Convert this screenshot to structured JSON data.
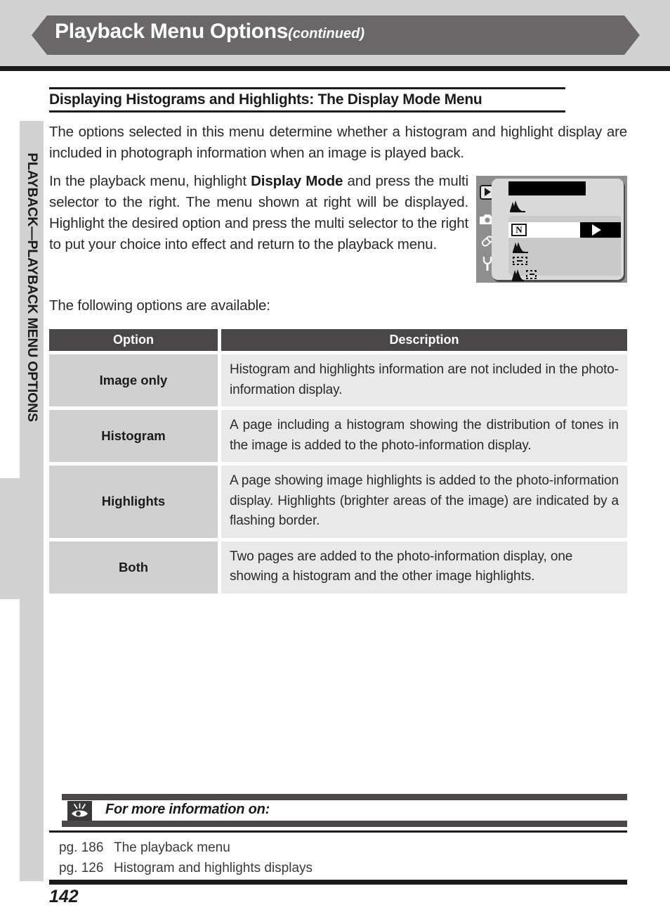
{
  "header": {
    "title": "Playback Menu Options",
    "continued": "(continued)"
  },
  "sidebar": {
    "tab_label": "PLAYBACK—PLAYBACK MENU OPTIONS"
  },
  "section": {
    "heading": "Displaying Histograms and Highlights: The Display Mode Menu",
    "paragraph_1": "The options selected in this menu determine whether a histogram and highlight display are included in photograph information when an image is played back.",
    "paragraph_2_part1": "In the playback menu, highlight ",
    "paragraph_2_bold": "Display Mode",
    "paragraph_2_part2": " and press the multi selector to the right.  The menu shown at right will be displayed.  Highlight the desired option and press the multi selector to the right to put your choice into effect and return to the playback menu.",
    "paragraph_3": "The following options are available:"
  },
  "lcd": {
    "sidebar_icons": [
      "playback-icon",
      "camera-icon",
      "pencil-icon",
      "wrench-icon"
    ],
    "title_bar": "",
    "selected_option_label": "N",
    "options": [
      "image-only-icon",
      "histogram-icon",
      "highlights-icon",
      "both-icon"
    ]
  },
  "table": {
    "headers": {
      "option": "Option",
      "description": "Description"
    },
    "rows": [
      {
        "option": "Image only",
        "description": "Histogram and highlights information are not included in the photo-information display."
      },
      {
        "option": "Histogram",
        "description": "A page including a histogram showing the distribution of tones in the image is added to the photo-information display."
      },
      {
        "option": "Highlights",
        "description": "A page showing image highlights is added to the photo-information display.  Highlights (brighter areas of the image) are indicated by a flashing border."
      },
      {
        "option": "Both",
        "description": "Two pages are added to the photo-information display, one showing a histogram and the other image highlights."
      }
    ]
  },
  "footer": {
    "info_title": "For more information on:",
    "info_icon": "eye-icon",
    "references": [
      {
        "page": "pg. 186",
        "text": "The playback menu"
      },
      {
        "page": "pg. 126",
        "text": "Histogram and highlights displays"
      }
    ],
    "page_number": "142"
  },
  "colors": {
    "banner": "#6b6869",
    "strip": "#d2d2d2",
    "table_header": "#4a4748",
    "option_cell": "#d0d0d0",
    "description_cell": "#e9e9e9",
    "rule": "#1b1b1b"
  }
}
